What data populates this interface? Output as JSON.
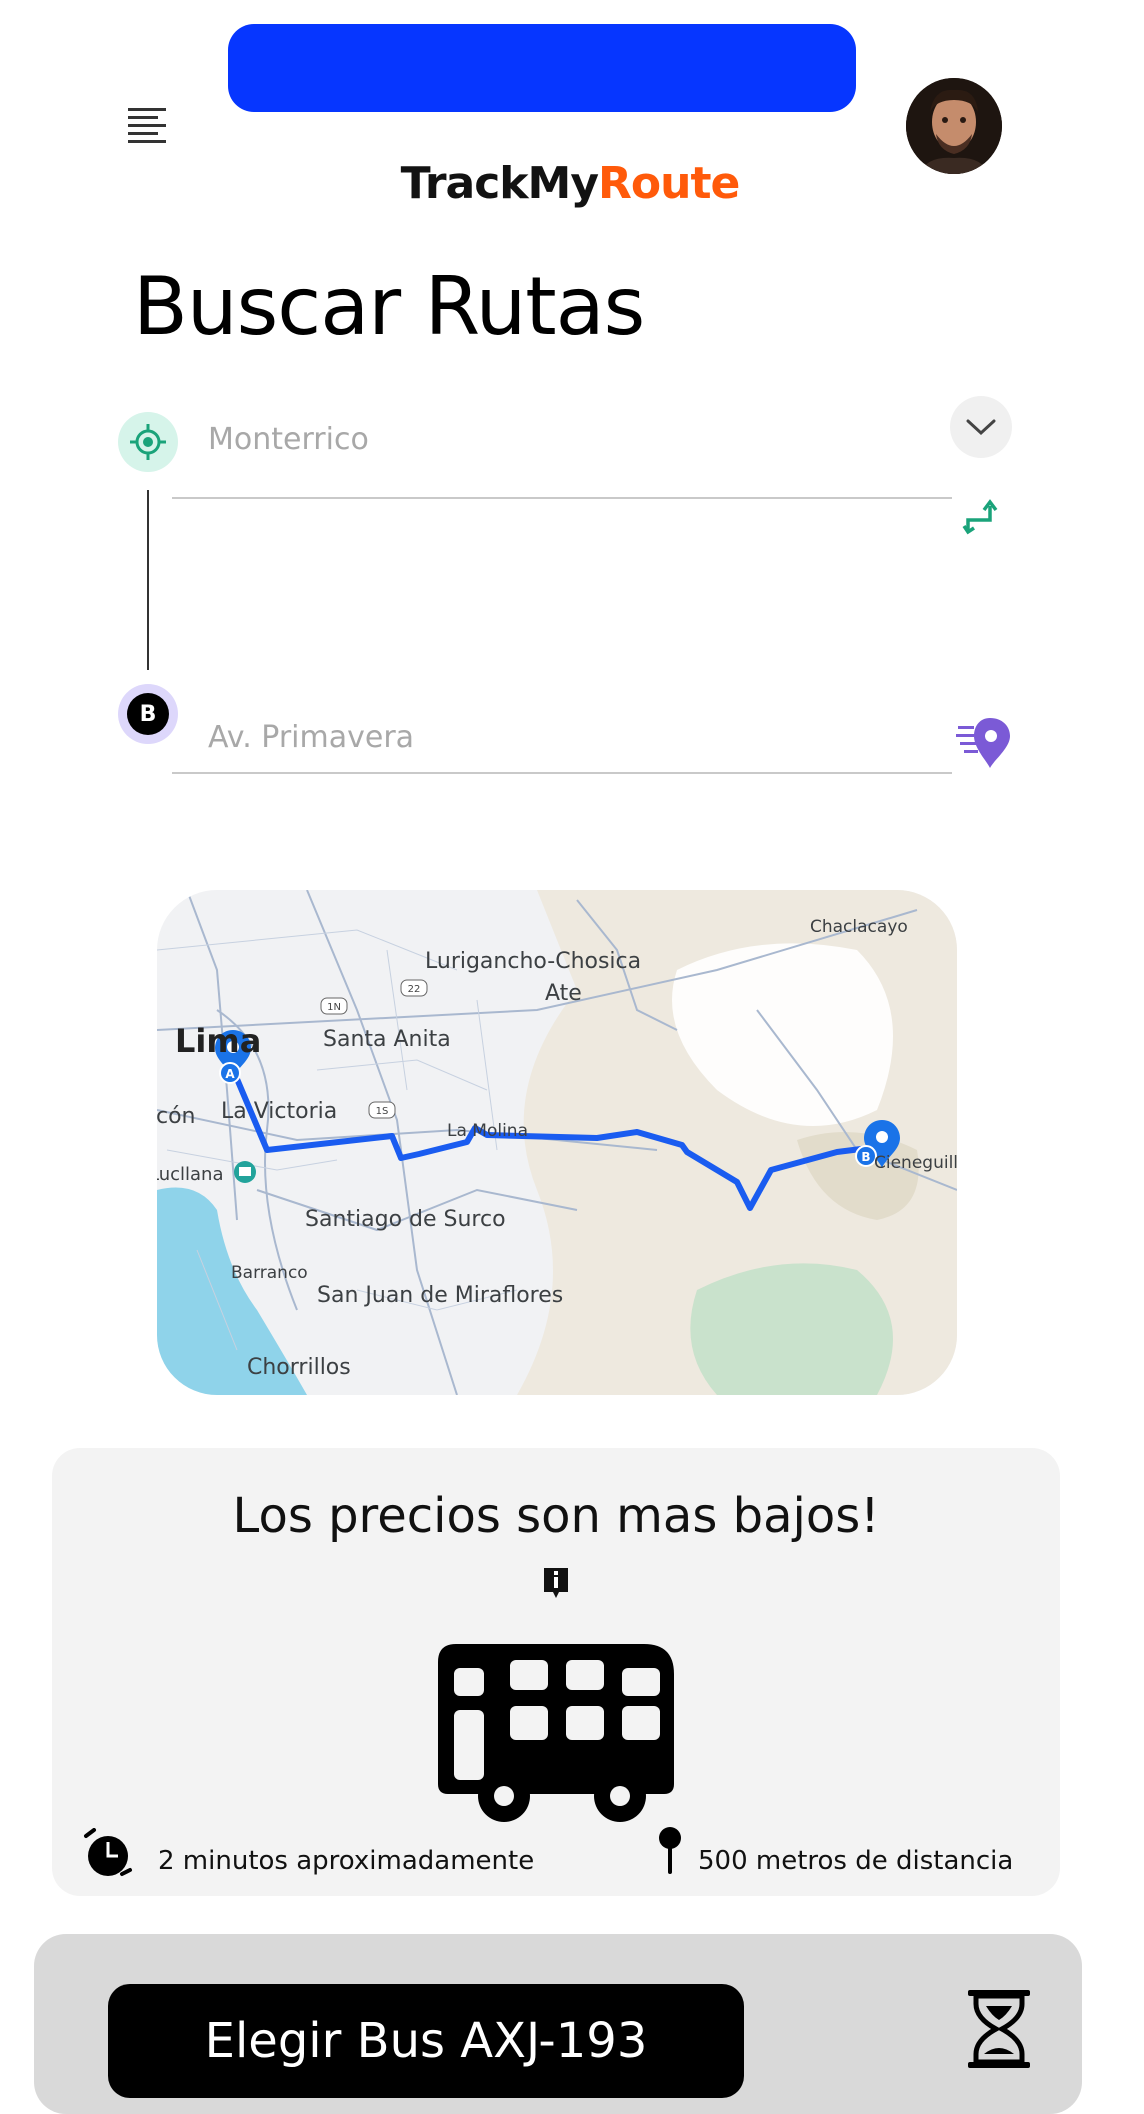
{
  "header": {
    "brand_part1": "TrackMy",
    "brand_part2": "Route",
    "brand_color_primary": "#121212",
    "brand_color_accent": "#ff5a0a",
    "banner_color": "#0636ff",
    "menu_icon": "menu-icon",
    "avatar_icon": "user-avatar"
  },
  "page": {
    "title": "Buscar Rutas"
  },
  "route_form": {
    "origin_placeholder": "Monterrico",
    "destination_placeholder": "Av. Primavera",
    "destination_marker": "B",
    "origin_icon": "locate-target-icon",
    "dropdown_icon": "chevron-down-icon",
    "swap_icon": "swap-route-icon",
    "fast_pin_icon": "speed-pin-icon"
  },
  "map": {
    "labels": [
      "Chaclacayo",
      "Lurigancho-Chosica",
      "Ate",
      "Santa Anita",
      "Lima",
      "La Victoria",
      "La Molina",
      "Santiago de Surco",
      "Barranco",
      "San Juan de Miraflores",
      "Chorrillos",
      "Cieneguilla",
      "Ancón",
      "Lucllana"
    ],
    "route_color": "#1a5cf0",
    "marker_a": "A",
    "marker_b": "B",
    "road_badges": [
      "1N",
      "22",
      "1S"
    ]
  },
  "info_card": {
    "title": "Los precios son mas bajos!",
    "time_text": "2 minutos aproximadamente",
    "distance_text": "500 metros de distancia",
    "info_icon": "info-icon",
    "bus_icon": "bus-icon",
    "timer_icon": "timer-icon",
    "pin_icon": "pin-icon"
  },
  "bottom_bar": {
    "choose_button_label": "Elegir Bus AXJ-193",
    "hourglass_icon": "hourglass-icon"
  }
}
